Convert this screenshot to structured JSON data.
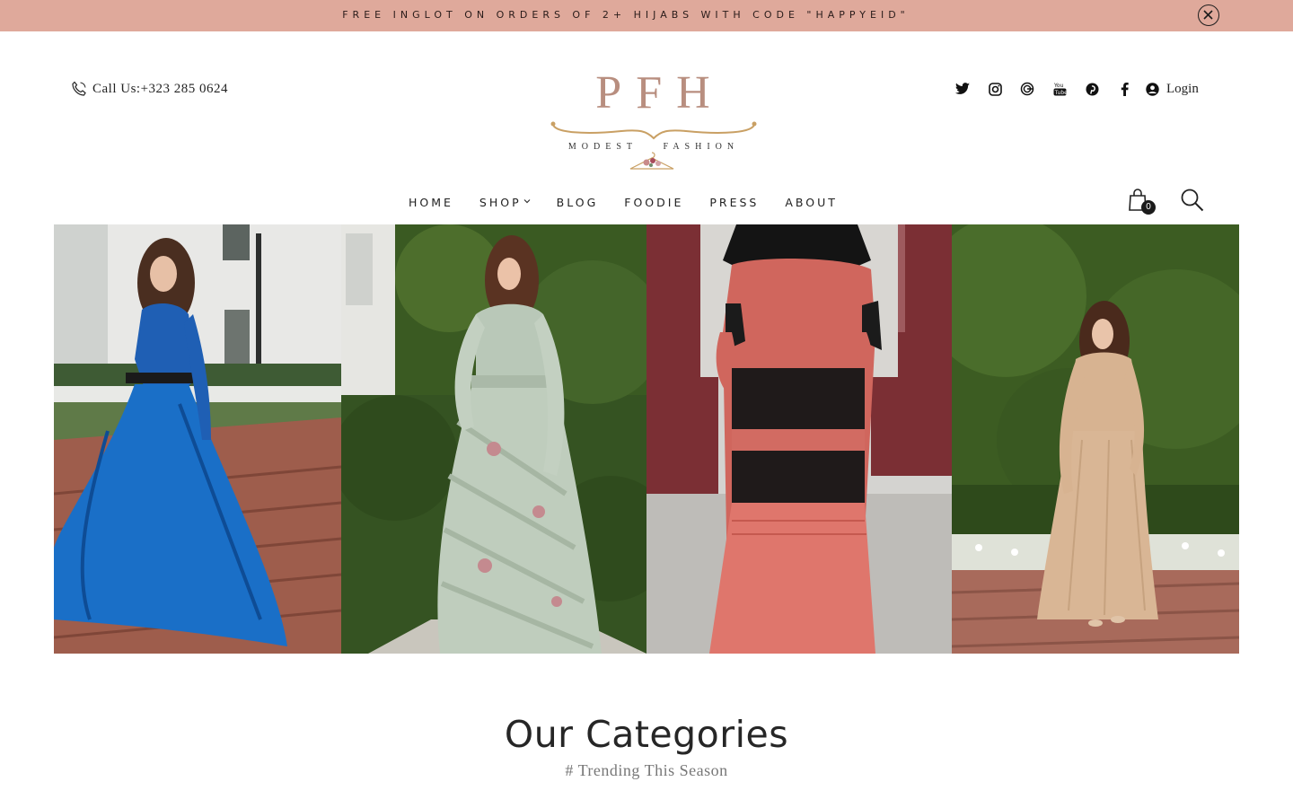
{
  "promo": {
    "text": "FREE INGLOT ON ORDERS OF 2+ HIJABS WITH CODE \"HAPPYEID\"",
    "background": "#dfa99b"
  },
  "header": {
    "call_label": "Call Us:+323 285 0624",
    "logo": {
      "mark": "PFH",
      "tagline_left": "MODEST",
      "tagline_right": "FASHION"
    },
    "social_icons": [
      "twitter-icon",
      "instagram-icon",
      "google-icon",
      "youtube-icon",
      "pinterest-icon",
      "facebook-icon"
    ],
    "login_label": "Login"
  },
  "nav": {
    "items": [
      {
        "label": "HOME"
      },
      {
        "label": "SHOP"
      },
      {
        "label": "BLOG"
      },
      {
        "label": "FOODIE"
      },
      {
        "label": "PRESS"
      },
      {
        "label": "ABOUT"
      }
    ]
  },
  "cart": {
    "count": "0"
  },
  "hero": {
    "panels": [
      {
        "name": "blue-satin-dress"
      },
      {
        "name": "sage-floral-dress"
      },
      {
        "name": "coral-lace-dress"
      },
      {
        "name": "beige-maxi-dress"
      }
    ]
  },
  "categories": {
    "title": "Our Categories",
    "subtitle": "# Trending This Season"
  },
  "colors": {
    "accent": "#dfa99b",
    "logo": "#b88e7f",
    "gold": "#c9a064"
  }
}
